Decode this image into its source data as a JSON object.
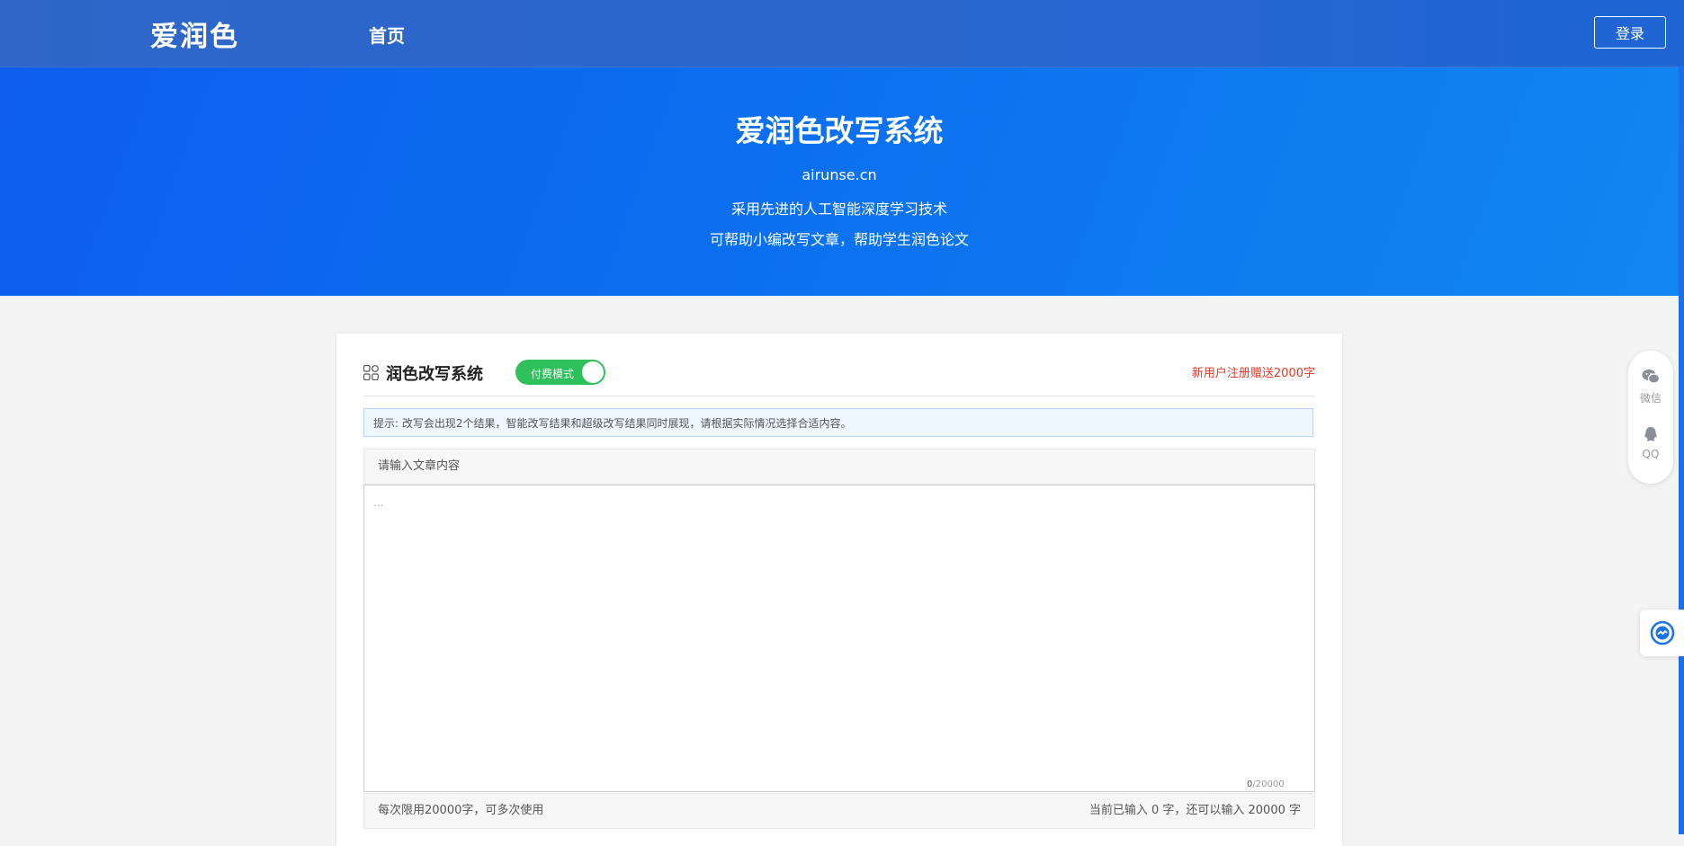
{
  "header": {
    "logo": "爱润色",
    "nav_home": "首页",
    "login_label": "登录"
  },
  "hero": {
    "title": "爱润色改写系统",
    "domain": "airunse.cn",
    "line1": "采用先进的人工智能深度学习技术",
    "line2": "可帮助小编改写文章，帮助学生润色论文"
  },
  "card": {
    "title": "润色改写系统",
    "mode_toggle_label": "付费模式",
    "promo": "新用户注册赠送2000字",
    "tip": "提示: 改写会出现2个结果，智能改写结果和超级改写结果同时展现，请根据实际情况选择合适内容。",
    "input_header": "请输入文章内容",
    "input_placeholder": "...",
    "input_value": "",
    "counter_current": "0",
    "counter_max": "/20000",
    "footer_left": "每次限用20000字，可多次使用",
    "footer_right": "当前已输入 0 字，还可以输入 20000 字"
  },
  "side": {
    "wechat_label": "微信",
    "qq_label": "QQ"
  },
  "colors": {
    "topbar": "#2866cf",
    "hero": "#0b6fef",
    "toggle": "#2ec05a",
    "promo": "#e23b2a"
  },
  "icons": [
    "grid-icon",
    "wechat-icon",
    "qq-icon",
    "ai-assistant-icon"
  ]
}
